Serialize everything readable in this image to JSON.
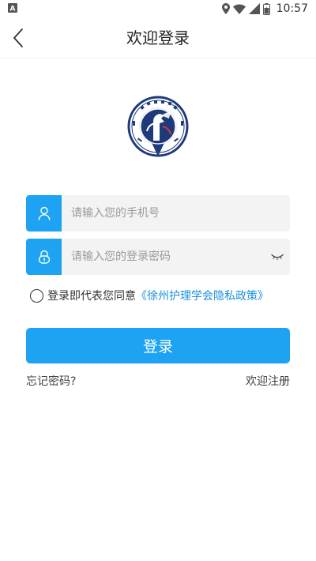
{
  "status_bar": {
    "time": "10:57",
    "icons": [
      "a-notification-icon",
      "location-icon",
      "wifi-icon",
      "signal-icon",
      "battery-icon"
    ]
  },
  "header": {
    "title": "欢迎登录",
    "back_icon": "chevron-left-icon"
  },
  "logo": {
    "name": "association-logo"
  },
  "form": {
    "phone": {
      "placeholder": "请输入您的手机号",
      "value": "",
      "icon": "user-icon"
    },
    "password": {
      "placeholder": "请输入您的登录密码",
      "value": "",
      "icon": "lock-icon",
      "toggle_icon": "eye-closed-icon"
    },
    "agreement": {
      "checked": false,
      "text": "登录即代表您同意",
      "link_text": "《徐州护理学会隐私政策》"
    },
    "login_label": "登录",
    "forgot_label": "忘记密码?",
    "register_label": "欢迎注册"
  },
  "colors": {
    "accent": "#1da3f2",
    "link": "#1a8fe0",
    "field_bg": "#f3f3f4",
    "logo_navy": "#1e3a7a"
  }
}
